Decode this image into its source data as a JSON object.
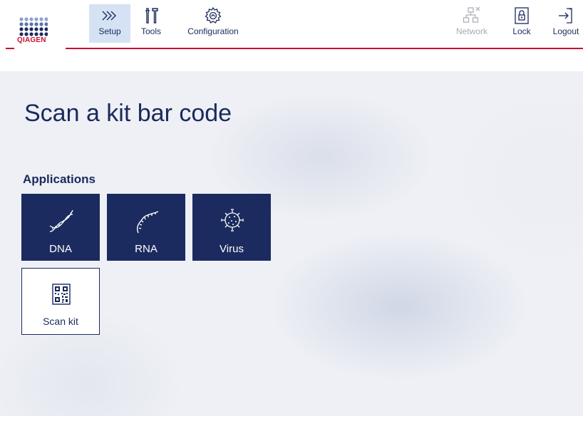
{
  "brand": {
    "logo_text": "QIAGEN",
    "accent_color": "#c8102e",
    "primary_color": "#1c2b5f"
  },
  "toolbar": {
    "left": [
      {
        "label": "Setup",
        "icon": "setup-chevrons-icon",
        "active": true
      },
      {
        "label": "Tools",
        "icon": "tools-icon",
        "active": false
      },
      {
        "label": "Configuration",
        "icon": "gear-icon",
        "active": false
      }
    ],
    "right": [
      {
        "label": "Network",
        "icon": "network-disconnected-icon",
        "disabled": true
      },
      {
        "label": "Lock",
        "icon": "lock-icon",
        "disabled": false
      },
      {
        "label": "Logout",
        "icon": "logout-icon",
        "disabled": false
      }
    ]
  },
  "main": {
    "title": "Scan a kit bar code",
    "section_label": "Applications",
    "tiles": [
      {
        "label": "DNA",
        "icon": "dna-helix-icon",
        "style": "dark"
      },
      {
        "label": "RNA",
        "icon": "rna-strand-icon",
        "style": "dark"
      },
      {
        "label": "Virus",
        "icon": "virus-icon",
        "style": "dark"
      },
      {
        "label": "Scan kit",
        "icon": "qr-code-icon",
        "style": "light"
      }
    ]
  }
}
